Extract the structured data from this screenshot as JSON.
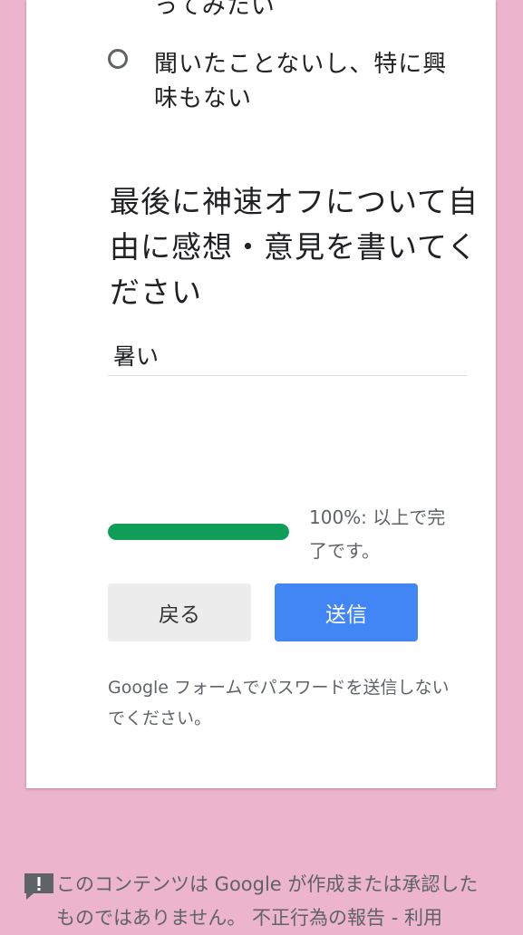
{
  "prev_option_tail": "ってみたい",
  "option": {
    "label": "聞いたことないし、特に興味もない"
  },
  "question": {
    "title": "最後に神速オフについて自由に感想・意見を書いてください",
    "answer": "暑い"
  },
  "progress": {
    "value": 1.0,
    "label": "100%: 以上で完了です。",
    "color": "#0f9d58"
  },
  "buttons": {
    "back": "戻る",
    "submit": "送信"
  },
  "password_warning": "Google フォームでパスワードを送信しないでください。",
  "footer": {
    "icon": "report-icon",
    "text": "このコンテンツは Google が作成または承認したものではありません。 不正行為の報告 - 利用"
  },
  "colors": {
    "background": "#ecb4cd",
    "accent": "#4285f4"
  }
}
